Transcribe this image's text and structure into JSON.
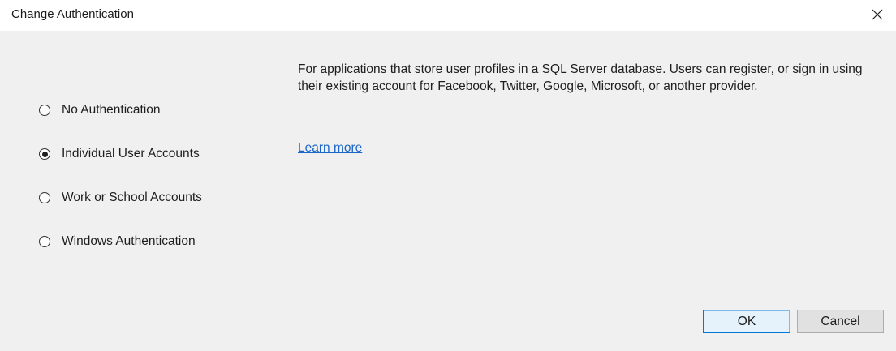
{
  "window": {
    "title": "Change Authentication",
    "close_icon": "close-icon"
  },
  "auth_options": [
    {
      "label": "No Authentication",
      "selected": false
    },
    {
      "label": "Individual User Accounts",
      "selected": true
    },
    {
      "label": "Work or School Accounts",
      "selected": false
    },
    {
      "label": "Windows Authentication",
      "selected": false
    }
  ],
  "details": {
    "description": "For applications that store user profiles in a SQL Server database. Users can register, or sign in using their existing account for Facebook, Twitter, Google, Microsoft, or another provider.",
    "learn_more": "Learn more"
  },
  "buttons": {
    "ok": "OK",
    "cancel": "Cancel"
  },
  "colors": {
    "link": "#1a66c8",
    "ok_border": "#0078d7",
    "background": "#f0f0f0"
  }
}
